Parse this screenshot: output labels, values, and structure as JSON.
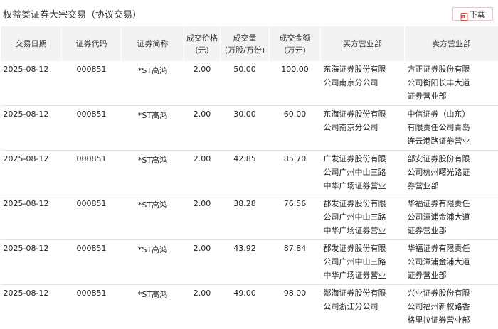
{
  "page": {
    "title": "权益类证券大宗交易（协议交易）",
    "download_label": "下载"
  },
  "table": {
    "headers": {
      "date": [
        "交易日期"
      ],
      "code": [
        "证券代码"
      ],
      "name": [
        "证券简称"
      ],
      "price": [
        "成交价格",
        "(元)"
      ],
      "volume": [
        "成交量",
        "(万股/万份)"
      ],
      "amount": [
        "成交金额",
        "(万元)"
      ],
      "buyer": [
        "买方营业部"
      ],
      "seller": [
        "卖方营业部"
      ]
    },
    "rows": [
      {
        "date": "2025-08-12",
        "code": "000851",
        "name": "*ST高鸿",
        "price": "2.00",
        "volume": "50.00",
        "amount": "100.00",
        "buyer": [
          "东海证券股份有限",
          "公司南京分公司"
        ],
        "seller": [
          "方正证券股份有限",
          "公司衡阳长丰大道",
          "证券营业部"
        ]
      },
      {
        "date": "2025-08-12",
        "code": "000851",
        "name": "*ST高鸿",
        "price": "2.00",
        "volume": "30.00",
        "amount": "60.00",
        "buyer": [
          "东海证券股份有限",
          "公司南京分公司"
        ],
        "seller": [
          "中信证券（山东）",
          "有限责任公司青岛",
          "连云港路证券营业"
        ]
      },
      {
        "date": "2025-08-12",
        "code": "000851",
        "name": "*ST高鸿",
        "price": "2.00",
        "volume": "42.85",
        "amount": "85.70",
        "buyer": [
          "广发证券股份有限",
          "公司广州中山三路",
          "中华广场证券营业"
        ],
        "seller": [
          "部安证券股份有限",
          "公司杭州曙光路证",
          "券营业部"
        ]
      },
      {
        "date": "2025-08-12",
        "code": "000851",
        "name": "*ST高鸿",
        "price": "2.00",
        "volume": "38.28",
        "amount": "76.56",
        "buyer": [
          "郡发证券股份有限",
          "公司广州中山三路",
          "中华广场证券营业"
        ],
        "seller": [
          "华福证券有限责任",
          "公司漳浦金浦大道",
          "证券营业部"
        ]
      },
      {
        "date": "2025-08-12",
        "code": "000851",
        "name": "*ST高鸿",
        "price": "2.00",
        "volume": "43.92",
        "amount": "87.84",
        "buyer": [
          "郡发证券股份有限",
          "公司广州中山三路",
          "中华广场证券营业"
        ],
        "seller": [
          "华福证券有限责任",
          "公司漳浦金浦大道",
          "证券营业部"
        ]
      },
      {
        "date": "2025-08-12",
        "code": "000851",
        "name": "*ST高鸿",
        "price": "2.00",
        "volume": "49.00",
        "amount": "98.00",
        "buyer": [
          "鄰海证券股份有限",
          "公司浙江分公司"
        ],
        "seller": [
          "兴业证券股份有限",
          "公司福州新权路香",
          "格里拉证券营业部"
        ]
      }
    ]
  },
  "colors": {
    "header_bg": "#f3f3f3",
    "download_icon": "#d9534f",
    "row_divider": "#e3e3e3"
  },
  "icons": {
    "download": "excel-download-icon"
  }
}
